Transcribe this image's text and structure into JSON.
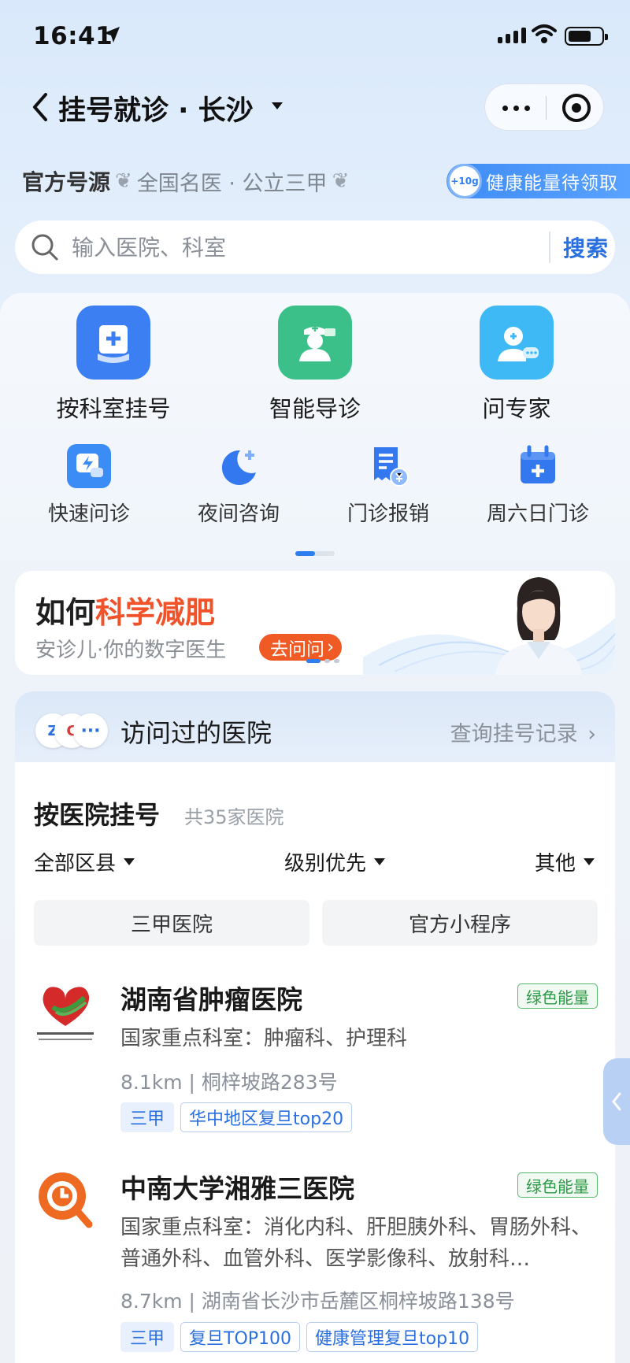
{
  "status": {
    "time": "16:41"
  },
  "nav": {
    "title": "挂号就诊 · 长沙"
  },
  "official": {
    "title": "官方号源",
    "subtitle": "全国名医 · 公立三甲",
    "energy_badge": "+10g",
    "energy_label": "健康能量待领取"
  },
  "search": {
    "placeholder": "输入医院、科室",
    "button": "搜索"
  },
  "features": {
    "big": [
      {
        "label": "按科室挂号",
        "icon": "department-icon",
        "color": "#3b7ff2"
      },
      {
        "label": "智能导诊",
        "icon": "nurse-icon",
        "color": "#3cc08a"
      },
      {
        "label": "问专家",
        "icon": "expert-icon",
        "color": "#3fb9f5"
      }
    ],
    "small": [
      {
        "label": "快速问诊",
        "icon": "quick-consult-icon"
      },
      {
        "label": "夜间咨询",
        "icon": "moon-icon"
      },
      {
        "label": "门诊报销",
        "icon": "receipt-icon"
      },
      {
        "label": "周六日门诊",
        "icon": "calendar-icon"
      }
    ]
  },
  "banner": {
    "title_prefix": "如何",
    "title_highlight": "科学减肥",
    "subtitle": "安诊儿·你的数字医生",
    "button": "去问问"
  },
  "visited": {
    "title": "访问过的医院",
    "link": "查询挂号记录"
  },
  "hospital_list": {
    "title": "按医院挂号",
    "count": "共35家医院",
    "filters": [
      "全部区县",
      "级别优先",
      "其他"
    ],
    "chips": [
      "三甲医院",
      "官方小程序"
    ],
    "items": [
      {
        "name": "湖南省肿瘤医院",
        "badge": "绿色能量",
        "departments": "国家重点科室：肿瘤科、护理科",
        "address": "8.1km | 桐梓坡路283号",
        "level": "三甲",
        "tags": [
          "华中地区复旦top20"
        ]
      },
      {
        "name": "中南大学湘雅三医院",
        "badge": "绿色能量",
        "departments": "国家重点科室：消化内科、肝胆胰外科、胃肠外科、普通外科、血管外科、医学影像科、放射科…",
        "address": "8.7km | 湖南省长沙市岳麓区桐梓坡路138号",
        "level": "三甲",
        "tags": [
          "复旦TOP100",
          "健康管理复旦top10"
        ]
      }
    ]
  }
}
